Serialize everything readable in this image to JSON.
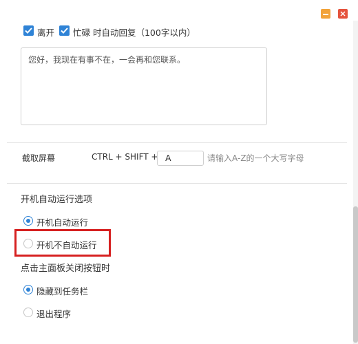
{
  "window": {
    "minimize_icon": "minimize-icon",
    "close_icon": "close-icon"
  },
  "auto_reply": {
    "away_label": "离开",
    "away_checked": true,
    "busy_label": "忙碌 时自动回复（100字以内）",
    "busy_checked": true,
    "message": "您好，我现在有事不在，一会再和您联系。"
  },
  "screenshot": {
    "label": "截取屏幕",
    "combo": "CTRL + SHIFT +",
    "key_value": "A",
    "hint": "请输入A-Z的一个大写字母"
  },
  "startup": {
    "title": "开机自动运行选项",
    "options": [
      {
        "label": "开机自动运行",
        "checked": true
      },
      {
        "label": "开机不自动运行",
        "checked": false
      }
    ]
  },
  "close_behavior": {
    "title": "点击主面板关闭按钮时",
    "options": [
      {
        "label": "隐藏到任务栏",
        "checked": true
      },
      {
        "label": "退出程序",
        "checked": false
      }
    ]
  },
  "colors": {
    "accent": "#2f83d6",
    "highlight": "#d62020",
    "minimize": "#f2a33a",
    "close": "#e5533d"
  }
}
